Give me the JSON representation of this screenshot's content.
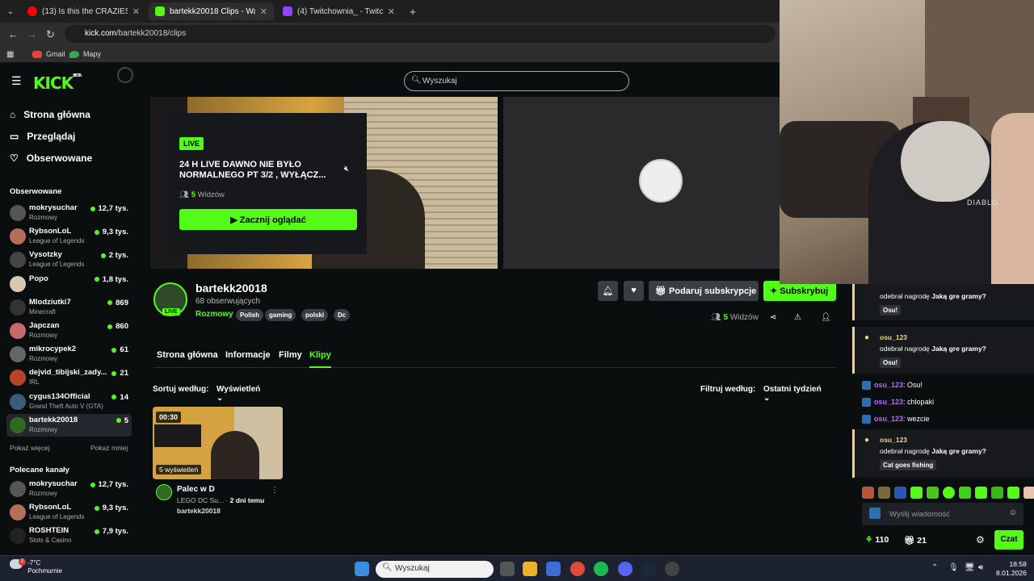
{
  "browser": {
    "tabs": [
      {
        "label": "(13) Is this the CRAZIEST BBQ? T",
        "color": "#ff0000"
      },
      {
        "label": "bartekk20018 Clips - Watch Live",
        "color": "#53fc18"
      },
      {
        "label": "(4) Twitchownia_ - Twitch",
        "color": "#9146ff"
      }
    ],
    "url_host": "kick.com",
    "url_path": "/bartekk20018/clips",
    "bookmarks": [
      "Gmail",
      "Mapy"
    ]
  },
  "kick": {
    "logo": "KICK",
    "logo_sup": "BETA",
    "search_placeholder": "Wyszukaj"
  },
  "sidebar": {
    "nav": [
      {
        "label": "Strona główna",
        "icon": "home-icon"
      },
      {
        "label": "Przeglądaj",
        "icon": "browse-icon"
      },
      {
        "label": "Obserwowane",
        "icon": "heart-icon"
      }
    ],
    "followed_heading": "Obserwowane",
    "followed": [
      {
        "name": "mokrysuchar",
        "category": "Rozmowy",
        "viewers": "12,7 tys.",
        "color": "#555"
      },
      {
        "name": "RybsonLoL",
        "category": "League of Legends",
        "viewers": "9,3 tys.",
        "color": "#b46f57"
      },
      {
        "name": "Vysotzky",
        "category": "League of Legends",
        "viewers": "2 tys.",
        "color": "#444"
      },
      {
        "name": "Popo",
        "category": "",
        "viewers": "1,8 tys.",
        "color": "#d9c7b0"
      },
      {
        "name": "Mlodziutki7",
        "category": "Minecraft",
        "viewers": "869",
        "color": "#333"
      },
      {
        "name": "Japczan",
        "category": "Rozmowy",
        "viewers": "860",
        "color": "#c46a6a"
      },
      {
        "name": "mikrocypek2",
        "category": "Rozmowy",
        "viewers": "61",
        "color": "#666"
      },
      {
        "name": "dejvid_tibijski_zady...",
        "category": "IRL",
        "viewers": "21",
        "color": "#b5442a"
      },
      {
        "name": "cygus134Official",
        "category": "Grand Theft Auto V (GTA)",
        "viewers": "14",
        "color": "#3d5a7a"
      },
      {
        "name": "bartekk20018",
        "category": "Rozmowy",
        "viewers": "5",
        "color": "#2f6a22"
      }
    ],
    "show_more": "Pokaż więcej",
    "show_less": "Pokaż mniej",
    "recommended_heading": "Polecane kanały",
    "recommended": [
      {
        "name": "mokrysuchar",
        "category": "Rozmowy",
        "viewers": "12,7 tys.",
        "color": "#555"
      },
      {
        "name": "RybsonLoL",
        "category": "League of Legends",
        "viewers": "9,3 tys.",
        "color": "#b46f57"
      },
      {
        "name": "ROSHTEIN",
        "category": "Slots & Casino",
        "viewers": "7,9 tys.",
        "color": "#222"
      }
    ]
  },
  "player": {
    "live_label": "LIVE",
    "title": "24 H LIVE DAWNO NIE BYŁO NORMALNEGO PT 3/2 , WYŁĄCZ...",
    "viewers_count": "5",
    "viewers_label": "Widzów",
    "watch_button": "Zacznij oglądać"
  },
  "channel": {
    "name": "bartekk20018",
    "followers": "68 obserwujących",
    "category": "Rozmowy",
    "live_badge": "LIVE",
    "tags": [
      "Polish",
      "gaming",
      "polski",
      "Dc"
    ],
    "gift_button": "Podaruj subskrypcje",
    "subscribe_button": "Subskrybuj",
    "viewers_count": "5",
    "viewers_label": "Widzów",
    "tabs": [
      "Strona główna",
      "Informacje",
      "Filmy",
      "Klipy"
    ],
    "active_tab": "Klipy"
  },
  "clips": {
    "sort_label": "Sortuj według:",
    "sort_value": "Wyświetleń",
    "filter_label": "Filtruj według:",
    "filter_value": "Ostatni tydzień",
    "items": [
      {
        "duration": "00:30",
        "views": "5 wyświetleń",
        "title": "Palec w D",
        "category": "LEGO DC Su...",
        "age": "2 dni temu",
        "author": "bartekk20018"
      }
    ]
  },
  "webcam": {
    "chair_brand": "DIABLO"
  },
  "chat": {
    "rewards": [
      {
        "user": "osu_123",
        "text_prefix": "odebrał nagrodę",
        "reward": "Jaką gre gramy?",
        "answer": "Osu!"
      },
      {
        "user": "osu_123",
        "text_prefix": "odebrał nagrodę",
        "reward": "Jaką gre gramy?",
        "answer": "Osu!"
      },
      {
        "user": "osu_123",
        "text_prefix": "odebrał nagrodę",
        "reward": "Jaką gre gramy?",
        "answer": "Cat goes fishing"
      }
    ],
    "messages": [
      {
        "user": "osu_123",
        "text": "Osu!"
      },
      {
        "user": "osu_123",
        "text": "chlopaki"
      },
      {
        "user": "osu_123",
        "text": "wezcie"
      }
    ],
    "input_placeholder": "Wyślij wiadomość",
    "points": "110",
    "gifts": "21",
    "chat_button": "Czat"
  },
  "taskbar": {
    "temperature": "-7°C",
    "weather": "Pochmurnie",
    "search_placeholder": "Wyszukaj",
    "time": "18:58",
    "date": "8.01.2026",
    "weather_badge": "2"
  }
}
